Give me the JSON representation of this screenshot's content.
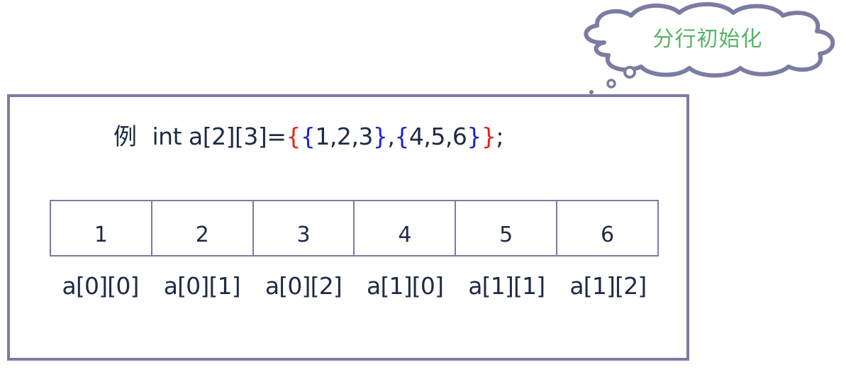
{
  "callout": {
    "text": "分行初始化",
    "text_color": "#58b368",
    "outline_color": "#7b7ca3"
  },
  "code": {
    "prefix": "例",
    "decl": "int a[2][3]=",
    "brace_open_outer": "{",
    "brace_open_1": "{",
    "row1": "1,2,3",
    "brace_close_1": "}",
    "comma": ",",
    "brace_open_2": "{",
    "row2": "4,5,6",
    "brace_close_2": "}",
    "brace_close_outer": "}",
    "end": ";",
    "outer_brace_color": "#e8201c",
    "inner_brace_color": "#1a23d6"
  },
  "memory": {
    "values": [
      "1",
      "2",
      "3",
      "4",
      "5",
      "6"
    ],
    "labels": [
      "a[0][0]",
      "a[0][1]",
      "a[0][2]",
      "a[1][0]",
      "a[1][1]",
      "a[1][2]"
    ]
  },
  "colors": {
    "frame": "#7b7ca3",
    "text": "#1f2a44"
  }
}
